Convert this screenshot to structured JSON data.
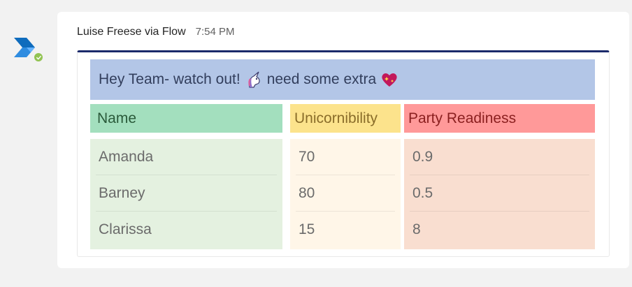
{
  "message": {
    "sender": "Luise Freese via Flow",
    "time": "7:54 PM"
  },
  "card": {
    "banner_text_before": "Hey Team- watch out!",
    "banner_text_after": "need some extra",
    "banner_icons": [
      "unicorn-icon",
      "sparkling-heart-icon"
    ],
    "columns": [
      {
        "header": "Name",
        "values": [
          "Amanda",
          "Barney",
          "Clarissa"
        ]
      },
      {
        "header": "Unicornibility",
        "values": [
          "70",
          "80",
          "15"
        ]
      },
      {
        "header": "Party Readiness",
        "values": [
          "0.9",
          "0.5",
          "8"
        ]
      }
    ]
  },
  "colors": {
    "accent_line": "#1b2a6b",
    "banner_bg": "#b3c6e7",
    "name_header_bg": "#a3dfbe",
    "name_body_bg": "#e4f1e0",
    "uni_header_bg": "#fce38c",
    "uni_body_bg": "#fff6e8",
    "party_header_bg": "#ff9999",
    "party_body_bg": "#f9ded0",
    "presence": "#92c353"
  }
}
